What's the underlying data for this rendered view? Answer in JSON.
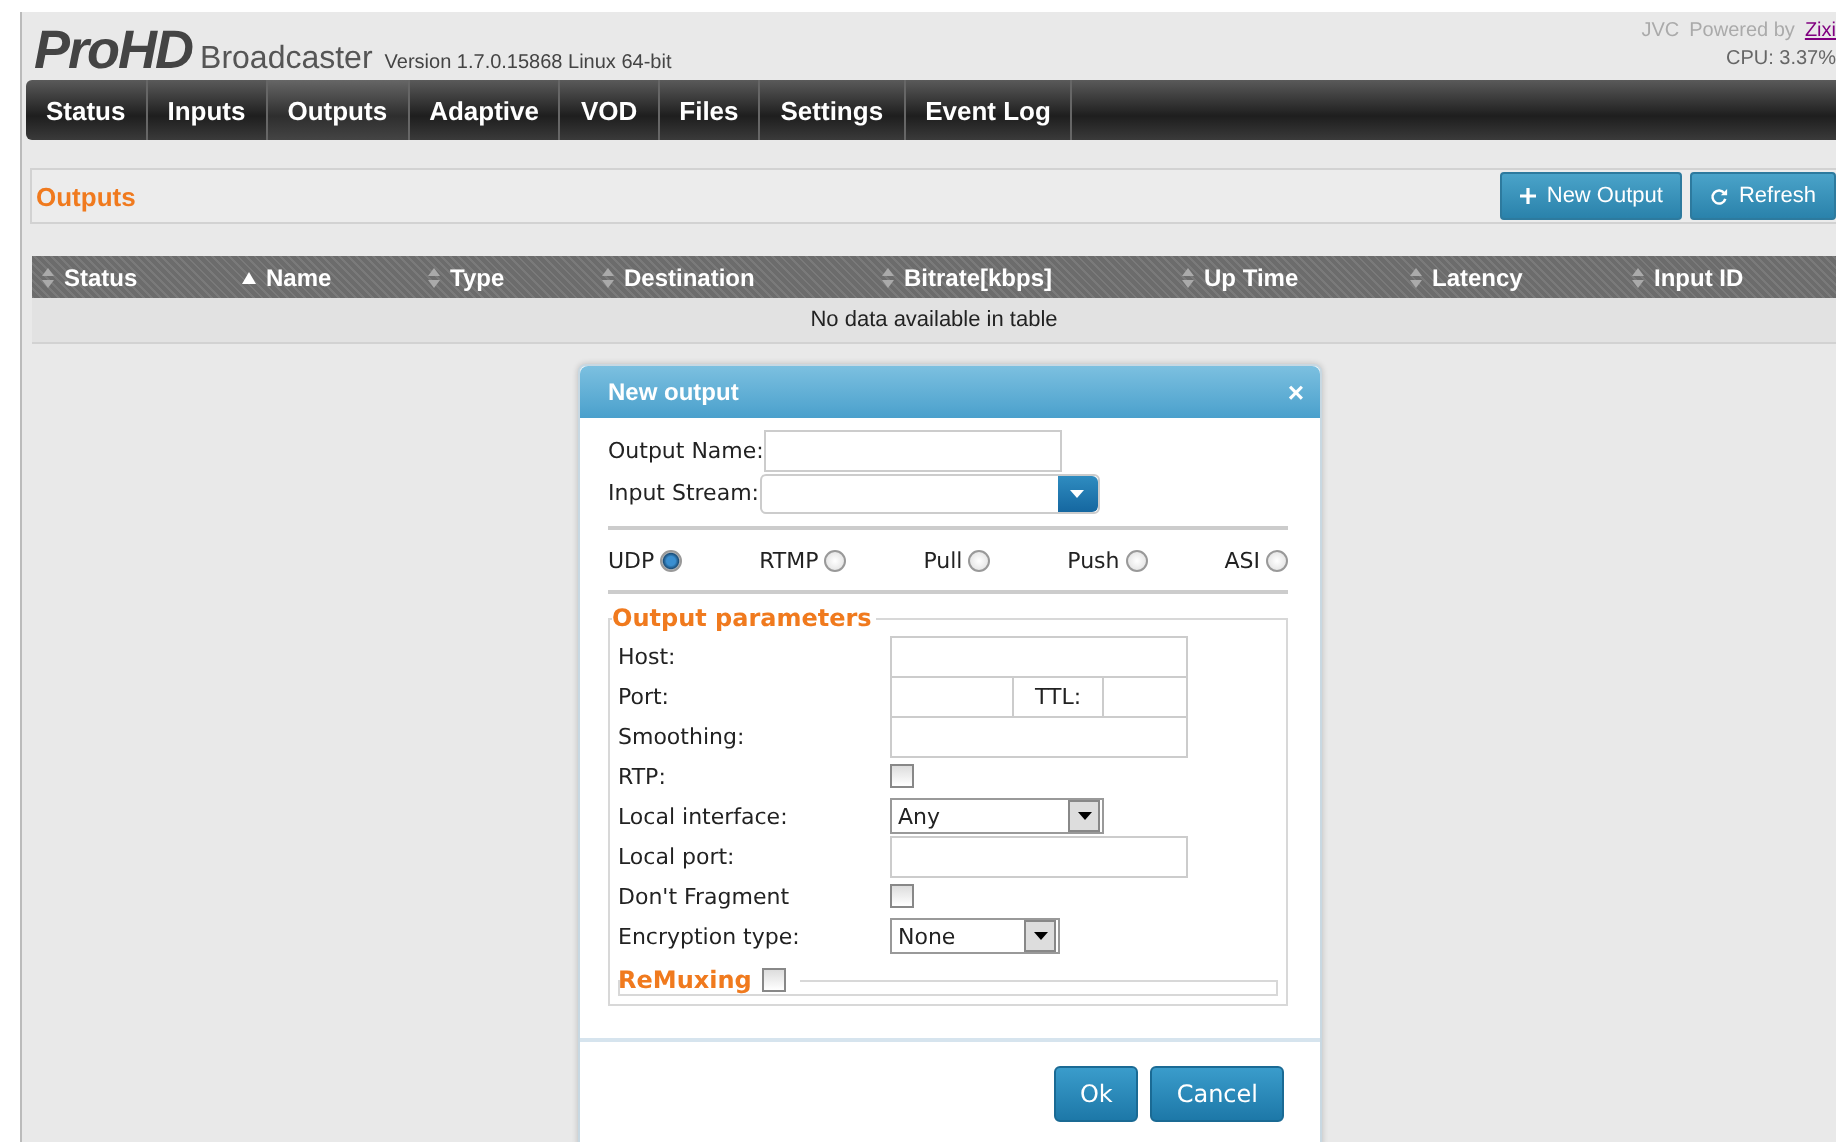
{
  "header": {
    "logo": "ProHD",
    "product": "Broadcaster",
    "version": "Version 1.7.0.15868 Linux 64-bit",
    "vendor": "JVC",
    "powered_by": "Powered by",
    "powered_link": "Zixi",
    "cpu": "CPU: 3.37%"
  },
  "tabs": [
    {
      "label": "Status",
      "selected": false
    },
    {
      "label": "Inputs",
      "selected": false
    },
    {
      "label": "Outputs",
      "selected": true
    },
    {
      "label": "Adaptive",
      "selected": false
    },
    {
      "label": "VOD",
      "selected": false
    },
    {
      "label": "Files",
      "selected": false
    },
    {
      "label": "Settings",
      "selected": false
    },
    {
      "label": "Event Log",
      "selected": false
    }
  ],
  "toolbar": {
    "title": "Outputs",
    "buttons": [
      {
        "label": "New Output"
      },
      {
        "label": "Refresh"
      }
    ]
  },
  "table": {
    "columns": [
      {
        "label": "Status",
        "sorted": false
      },
      {
        "label": "Name",
        "sorted": true
      },
      {
        "label": "Type",
        "sorted": false
      },
      {
        "label": "Destination",
        "sorted": false
      },
      {
        "label": "Bitrate[kbps]",
        "sorted": false
      },
      {
        "label": "Up Time",
        "sorted": false
      },
      {
        "label": "Latency",
        "sorted": false
      },
      {
        "label": "Input ID",
        "sorted": false
      }
    ],
    "empty_message": "No data available in table"
  },
  "dialog": {
    "title": "New output",
    "close": "×",
    "fields": [
      {
        "kind": "text",
        "label": "Output Name:"
      },
      {
        "kind": "combo",
        "label": "Input Stream:"
      }
    ],
    "protocols": [
      {
        "label": "UDP",
        "selected": true
      },
      {
        "label": "RTMP",
        "selected": false
      },
      {
        "label": "Pull",
        "selected": false
      },
      {
        "label": "Push",
        "selected": false
      },
      {
        "label": "ASI",
        "selected": false
      }
    ],
    "parameters": {
      "legend": "Output parameters",
      "rows": [
        {
          "kind": "text",
          "label": "Host:"
        },
        {
          "kind": "port",
          "label": "Port:",
          "extra_label": "TTL:"
        },
        {
          "kind": "text",
          "label": "Smoothing:"
        },
        {
          "kind": "checkbox",
          "label": "RTP:",
          "checked": false
        },
        {
          "kind": "select",
          "label": "Local interface:",
          "value": "Any"
        },
        {
          "kind": "text",
          "label": "Local port:"
        },
        {
          "kind": "checkbox",
          "label": "Don't Fragment",
          "checked": false
        },
        {
          "kind": "select",
          "label": "Encryption type:",
          "value": "None"
        }
      ]
    },
    "remuxing": {
      "legend": "ReMuxing",
      "checked": false
    },
    "buttons": [
      "Ok",
      "Cancel"
    ]
  }
}
